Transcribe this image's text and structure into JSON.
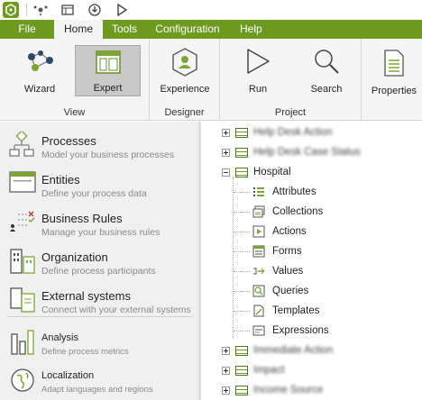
{
  "menu": {
    "tabs": [
      "File",
      "Home",
      "Tools",
      "Configuration",
      "Help"
    ],
    "active": "Home"
  },
  "ribbon": {
    "groups": [
      {
        "label": "View",
        "buttons": [
          "Wizard",
          "Expert"
        ]
      },
      {
        "label": "Designer",
        "buttons": [
          "Experience"
        ]
      },
      {
        "label": "Project",
        "buttons": [
          "Run",
          "Search"
        ]
      },
      {
        "label": "",
        "buttons": [
          "Properties"
        ]
      }
    ],
    "selected_button": "Expert"
  },
  "leftnav": {
    "items": [
      {
        "title": "Processes",
        "subtitle": "Model your business processes"
      },
      {
        "title": "Entities",
        "subtitle": "Define your process data"
      },
      {
        "title": "Business Rules",
        "subtitle": "Manage your business rules"
      },
      {
        "title": "Organization",
        "subtitle": "Define process participants"
      },
      {
        "title": "External systems",
        "subtitle": "Connect with your external systems"
      },
      {
        "title": "Analysis",
        "subtitle": "Define process metrics"
      },
      {
        "title": "Localization",
        "subtitle": "Adapt languages and regions"
      }
    ]
  },
  "tree": {
    "top_blurred": [
      "Help Desk Action",
      "Help Desk Case Status"
    ],
    "expanded": "Hospital",
    "children": [
      "Attributes",
      "Collections",
      "Actions",
      "Forms",
      "Values",
      "Queries",
      "Templates",
      "Expressions"
    ],
    "bottom_blurred": [
      "Immediate Action",
      "Impact",
      "Income Source"
    ]
  },
  "colors": {
    "brand_green": "#6d9a1f",
    "ribbon_bg": "#f5f5f5",
    "nav_bg": "#f0f0f0"
  }
}
